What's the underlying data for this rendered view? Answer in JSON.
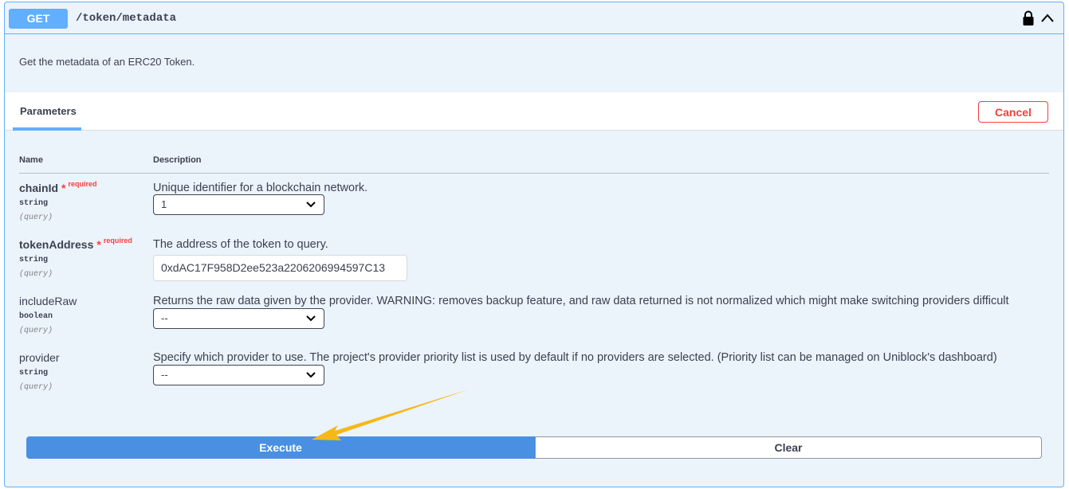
{
  "operation": {
    "method": "GET",
    "path": "/token/metadata",
    "description": "Get the metadata of an ERC20 Token."
  },
  "parameters_section": {
    "tab_label": "Parameters",
    "cancel_label": "Cancel",
    "col_name": "Name",
    "col_description": "Description"
  },
  "parameters": [
    {
      "name": "chainId",
      "required": true,
      "required_star": "*",
      "required_label": "required",
      "type": "string",
      "in": "(query)",
      "description": "Unique identifier for a blockchain network.",
      "value": "1"
    },
    {
      "name": "tokenAddress",
      "required": true,
      "required_star": "*",
      "required_label": "required",
      "type": "string",
      "in": "(query)",
      "description": "The address of the token to query.",
      "value": "0xdAC17F958D2ee523a2206206994597C13"
    },
    {
      "name": "includeRaw",
      "required": false,
      "type": "boolean",
      "in": "(query)",
      "description": "Returns the raw data given by the provider. WARNING: removes backup feature, and raw data returned is not normalized which might make switching providers difficult",
      "value": "--"
    },
    {
      "name": "provider",
      "required": false,
      "type": "string",
      "in": "(query)",
      "description": "Specify which provider to use. The project's provider priority list is used by default if no providers are selected. (Priority list can be managed on Uniblock's dashboard)",
      "value": "--"
    }
  ],
  "actions": {
    "execute_label": "Execute",
    "clear_label": "Clear"
  },
  "colors": {
    "get_accent": "#61affe",
    "execute": "#4990e2",
    "danger": "#f93e3e",
    "annotation_arrow": "#f5b816"
  },
  "icons": {
    "lock": "lock-icon",
    "collapse": "chevron-up-icon",
    "select_caret": "chevron-down-icon",
    "annotation": "arrow-annotation"
  }
}
